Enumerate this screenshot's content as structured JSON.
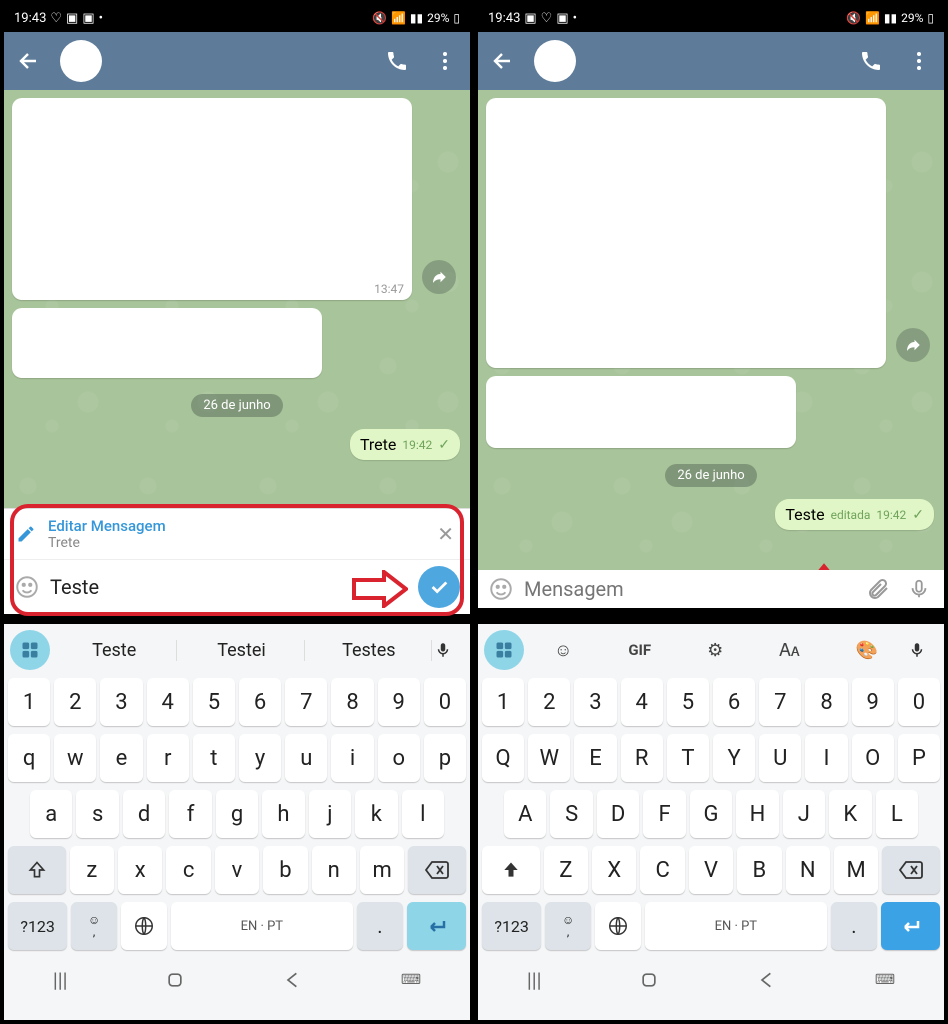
{
  "status": {
    "time": "19:43",
    "battery": "29%"
  },
  "chat": {
    "date_chip": "26 de junho",
    "incoming_time": "13:47"
  },
  "screen1": {
    "msg_out": {
      "text": "Trete",
      "time": "19:42"
    },
    "edit": {
      "title": "Editar Mensagem",
      "sub": "Trete"
    },
    "input_value": "Teste",
    "suggestions": [
      "Teste",
      "Testei",
      "Testes"
    ],
    "kb_numbers": [
      "1",
      "2",
      "3",
      "4",
      "5",
      "6",
      "7",
      "8",
      "9",
      "0"
    ],
    "kb_row1": [
      "q",
      "w",
      "e",
      "r",
      "t",
      "y",
      "u",
      "i",
      "o",
      "p"
    ],
    "kb_row2": [
      "a",
      "s",
      "d",
      "f",
      "g",
      "h",
      "j",
      "k",
      "l"
    ],
    "kb_row3": [
      "z",
      "x",
      "c",
      "v",
      "b",
      "n",
      "m"
    ],
    "kb_sym": "?123",
    "kb_lang": "EN · PT"
  },
  "screen2": {
    "msg_out": {
      "text": "Teste",
      "edited": "editada",
      "time": "19:42"
    },
    "input_placeholder": "Mensagem",
    "kb_numbers": [
      "1",
      "2",
      "3",
      "4",
      "5",
      "6",
      "7",
      "8",
      "9",
      "0"
    ],
    "kb_row1": [
      "Q",
      "W",
      "E",
      "R",
      "T",
      "Y",
      "U",
      "I",
      "O",
      "P"
    ],
    "kb_row2": [
      "A",
      "S",
      "D",
      "F",
      "G",
      "H",
      "J",
      "K",
      "L"
    ],
    "kb_row3": [
      "Z",
      "X",
      "C",
      "V",
      "B",
      "N",
      "M"
    ],
    "kb_sym": "?123",
    "kb_lang": "EN · PT"
  }
}
